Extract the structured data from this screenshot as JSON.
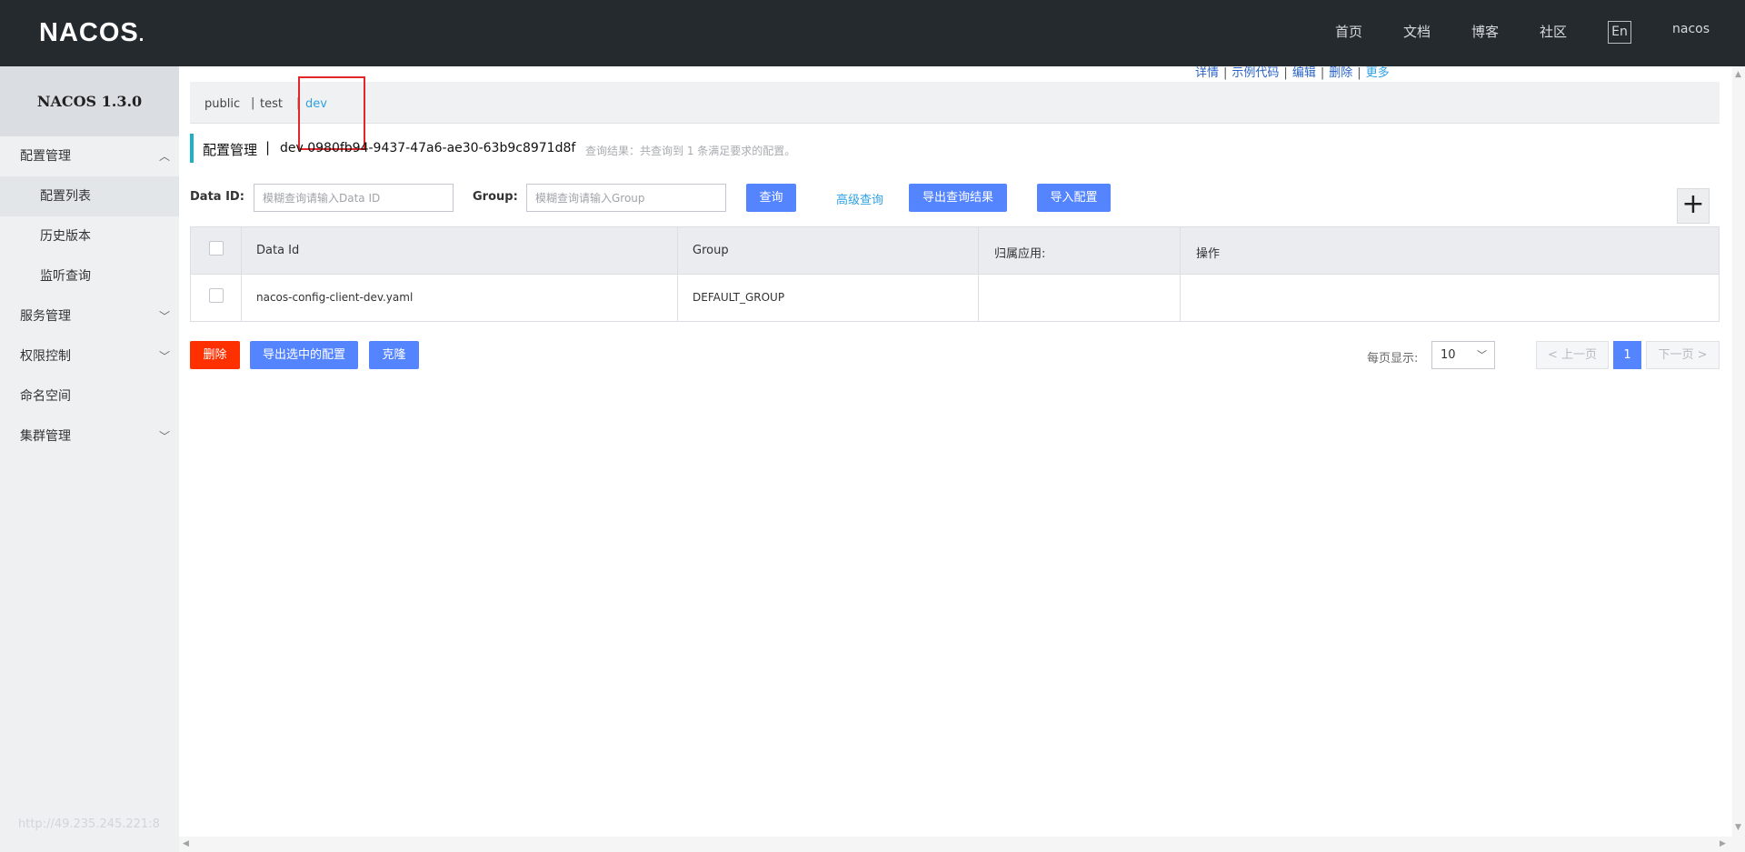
{
  "header": {
    "logo": "NACOS",
    "logo_dot": ".",
    "nav": [
      "首页",
      "文档",
      "博客",
      "社区"
    ],
    "lang_button": "En",
    "user": "nacos"
  },
  "sidebar": {
    "version_title": "NACOS 1.3.0",
    "items": [
      {
        "label": "配置管理",
        "chevron": "︿"
      },
      {
        "label": "配置列表"
      },
      {
        "label": "历史版本"
      },
      {
        "label": "监听查询"
      },
      {
        "label": "服务管理",
        "chevron": "﹀"
      },
      {
        "label": "权限控制",
        "chevron": "﹀"
      },
      {
        "label": "命名空间"
      },
      {
        "label": "集群管理",
        "chevron": "﹀"
      }
    ],
    "footer_url": "http://49.235.245.221:8"
  },
  "namespaces": {
    "items": [
      "public",
      "test",
      "dev"
    ],
    "separator": "|",
    "active": "dev"
  },
  "page": {
    "title": "配置管理",
    "title_sep": "|",
    "namespace_id": "dev  0980fb94-9437-47a6-ae30-63b9c8971d8f",
    "result_info": "查询结果：共查询到 1 条满足要求的配置。"
  },
  "filters": {
    "data_id_label": "Data ID:",
    "data_id_placeholder": "模糊查询请输入Data ID",
    "group_label": "Group:",
    "group_placeholder": "模糊查询请输入Group",
    "query_button": "查询",
    "advanced_query": "高级查询",
    "export_results": "导出查询结果",
    "import_config": "导入配置",
    "add_icon": "+"
  },
  "table": {
    "columns": [
      "Data Id",
      "Group",
      "归属应用:",
      "操作"
    ],
    "rows": [
      {
        "data_id": "nacos-config-client-dev.yaml",
        "group": "DEFAULT_GROUP",
        "app": ""
      }
    ],
    "operations": [
      "详情",
      "示例代码",
      "编辑",
      "删除",
      "更多"
    ],
    "op_separator": "|"
  },
  "bottom": {
    "delete_button": "删除",
    "export_selected": "导出选中的配置",
    "clone_button": "克隆",
    "per_page_label": "每页显示:",
    "per_page_value": "10",
    "prev": "上一页",
    "current_page": "1",
    "next": "下一页"
  },
  "colors": {
    "header_bg": "#252a2f",
    "primary": "#5584ff",
    "danger": "#ff3000",
    "link": "#2fa1e3",
    "highlight_box": "#e3262a"
  },
  "icons": {
    "checkbox": "checkbox-icon",
    "chevron_up": "chevron-up-icon",
    "chevron_down": "chevron-down-icon",
    "plus": "plus-icon",
    "prev_arrow": "chevron-left-icon",
    "next_arrow": "chevron-right-icon"
  }
}
